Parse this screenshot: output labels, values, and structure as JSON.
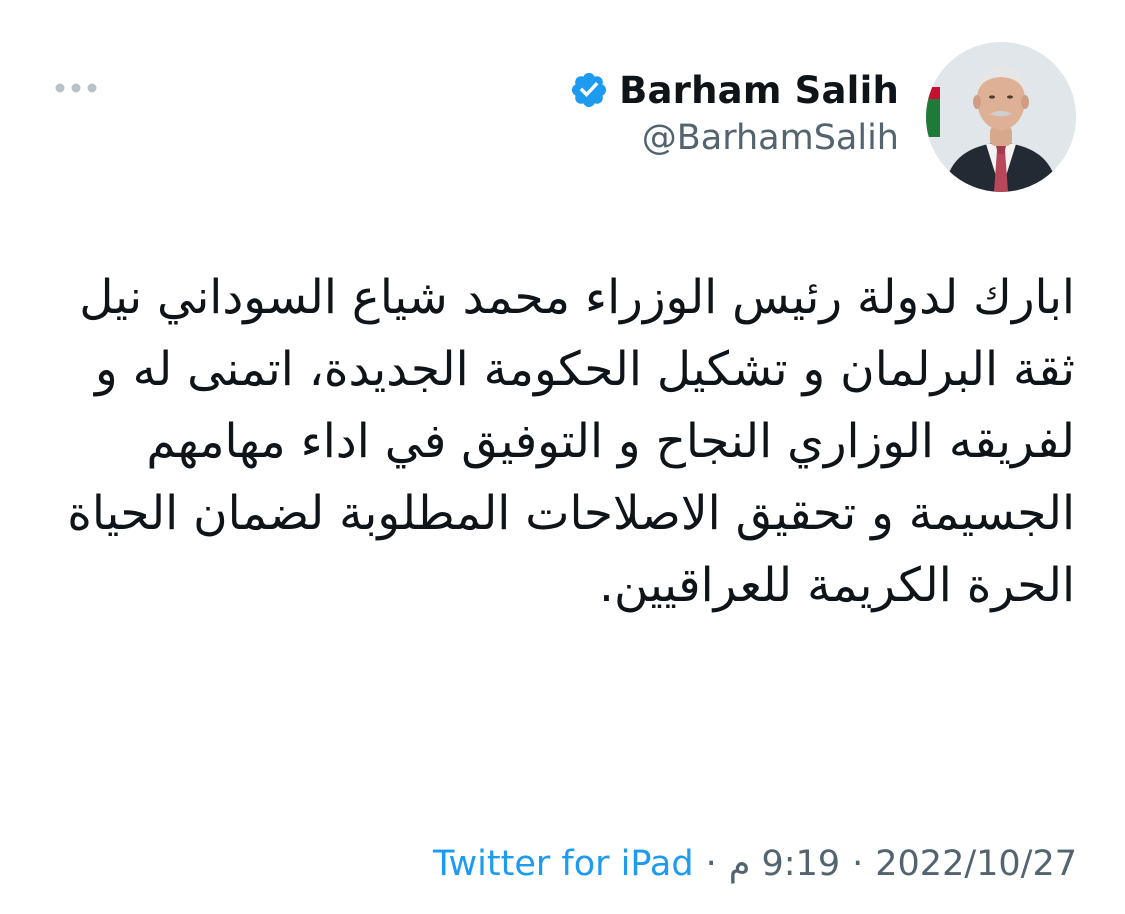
{
  "author": {
    "display_name": "Barham Salih",
    "handle": "@BarhamSalih",
    "verified": true,
    "avatar_icon": "profile-photo"
  },
  "icons": {
    "more": "more-horizontal-icon",
    "verified": "verified-badge-icon"
  },
  "colors": {
    "accent": "#1d9bf0",
    "text": "#0f1419",
    "muted": "#536471"
  },
  "tweet": {
    "text": "ابارك لدولة رئيس الوزراء محمد شياع السوداني نيل ثقة البرلمان و تشكيل الحكومة الجديدة، اتمنى له و لفريقه الوزاري النجاح و التوفيق في اداء مهامهم الجسيمة و تحقيق الاصلاحات المطلوبة لضمان الحياة الحرة الكريمة للعراقيين."
  },
  "meta": {
    "date": "2022/10/27",
    "time": "9:19 م",
    "source": "Twitter for iPad",
    "separator": "·"
  }
}
